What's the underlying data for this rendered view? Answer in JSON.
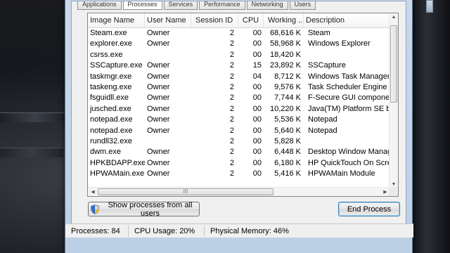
{
  "tabs": [
    "Applications",
    "Processes",
    "Services",
    "Performance",
    "Networking",
    "Users"
  ],
  "columns": {
    "image_name": "Image Name",
    "user_name": "User Name",
    "session_id": "Session ID",
    "cpu": "CPU",
    "working_set": "Working ...",
    "description": "Description"
  },
  "processes": [
    {
      "name": "Steam.exe",
      "user": "Owner",
      "session": "2",
      "cpu": "00",
      "mem": "68,616 K",
      "desc": "Steam"
    },
    {
      "name": "explorer.exe",
      "user": "Owner",
      "session": "2",
      "cpu": "00",
      "mem": "58,968 K",
      "desc": "Windows Explorer"
    },
    {
      "name": "csrss.exe",
      "user": "",
      "session": "2",
      "cpu": "00",
      "mem": "18,420 K",
      "desc": ""
    },
    {
      "name": "SSCapture.exe",
      "user": "Owner",
      "session": "2",
      "cpu": "15",
      "mem": "23,892 K",
      "desc": "SSCapture"
    },
    {
      "name": "taskmgr.exe",
      "user": "Owner",
      "session": "2",
      "cpu": "04",
      "mem": "8,712 K",
      "desc": "Windows Task Manager"
    },
    {
      "name": "taskeng.exe",
      "user": "Owner",
      "session": "2",
      "cpu": "00",
      "mem": "9,576 K",
      "desc": "Task Scheduler Engine"
    },
    {
      "name": "fsguidll.exe",
      "user": "Owner",
      "session": "2",
      "cpu": "00",
      "mem": "7,744 K",
      "desc": "F-Secure GUI component"
    },
    {
      "name": "jusched.exe",
      "user": "Owner",
      "session": "2",
      "cpu": "00",
      "mem": "10,220 K",
      "desc": "Java(TM) Platform SE binar"
    },
    {
      "name": "notepad.exe",
      "user": "Owner",
      "session": "2",
      "cpu": "00",
      "mem": "5,536 K",
      "desc": "Notepad"
    },
    {
      "name": "notepad.exe",
      "user": "Owner",
      "session": "2",
      "cpu": "00",
      "mem": "5,640 K",
      "desc": "Notepad"
    },
    {
      "name": "rundll32.exe",
      "user": "",
      "session": "2",
      "cpu": "00",
      "mem": "5,828 K",
      "desc": ""
    },
    {
      "name": "dwm.exe",
      "user": "Owner",
      "session": "2",
      "cpu": "00",
      "mem": "6,448 K",
      "desc": "Desktop Window Manager"
    },
    {
      "name": "HPKBDAPP.exe",
      "user": "Owner",
      "session": "2",
      "cpu": "00",
      "mem": "6,180 K",
      "desc": "HP QuickTouch On Screen D"
    },
    {
      "name": "HPWAMain.exe",
      "user": "Owner",
      "session": "2",
      "cpu": "00",
      "mem": "5,416 K",
      "desc": "HPWAMain Module"
    }
  ],
  "buttons": {
    "show_all": "Show processes from all users",
    "end_process": "End Process"
  },
  "status": {
    "processes": "Processes: 84",
    "cpu_usage": "CPU Usage: 20%",
    "physical_memory": "Physical Memory: 46%"
  },
  "scroll_grip": "III",
  "icons": {
    "show_all_button": "uac-shield-icon"
  }
}
